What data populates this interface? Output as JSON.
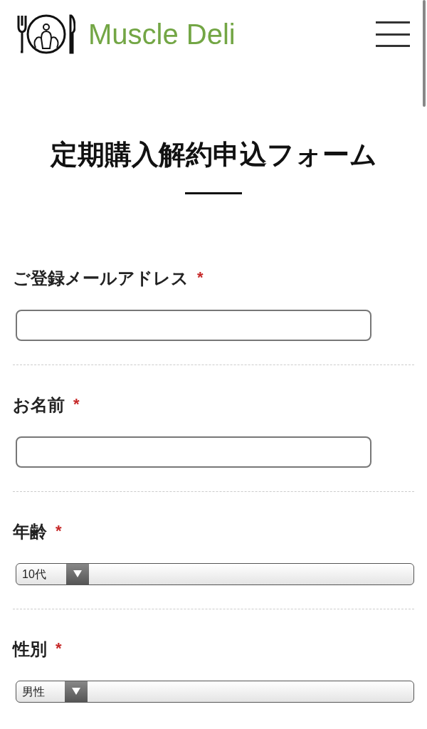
{
  "header": {
    "brand": "Muscle Deli"
  },
  "title": "定期購入解約申込フォーム",
  "required_mark": "*",
  "fields": [
    {
      "kind": "text",
      "label": "ご登録メールアドレス",
      "required": true
    },
    {
      "kind": "text",
      "label": "お名前",
      "required": true
    },
    {
      "kind": "select",
      "label": "年齢",
      "required": true,
      "value": "10代"
    },
    {
      "kind": "select",
      "label": "性別",
      "required": true,
      "value": "男性"
    }
  ]
}
